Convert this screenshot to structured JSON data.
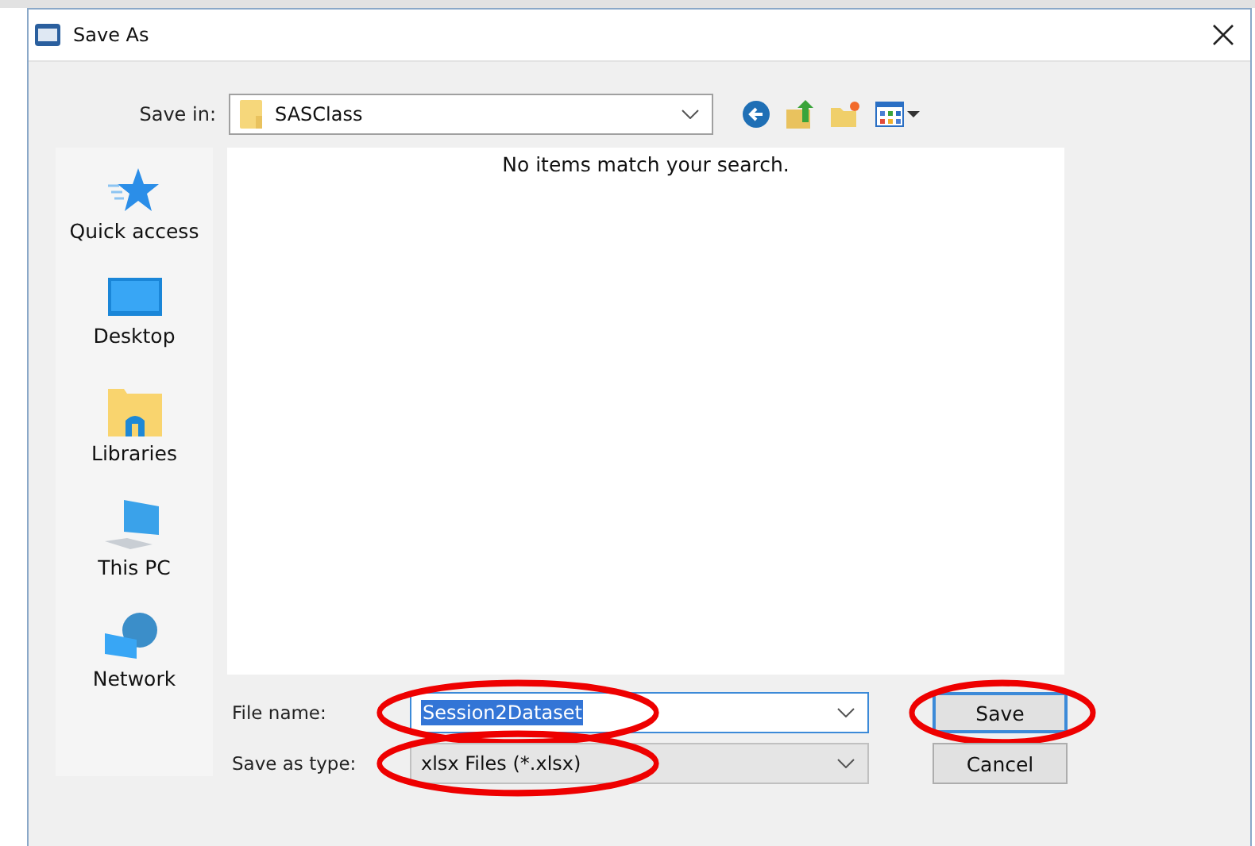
{
  "window": {
    "title": "Save As"
  },
  "save_in": {
    "label": "Save in:",
    "value": "SASClass"
  },
  "places": [
    {
      "kind": "star",
      "label": "Quick access"
    },
    {
      "kind": "desktop",
      "label": "Desktop"
    },
    {
      "kind": "libraries",
      "label": "Libraries"
    },
    {
      "kind": "pc",
      "label": "This PC"
    },
    {
      "kind": "network",
      "label": "Network"
    }
  ],
  "file_list": {
    "empty_message": "No items match your search."
  },
  "file_name": {
    "label": "File name:",
    "value": "Session2Dataset",
    "circled": true
  },
  "file_type": {
    "label": "Save as type:",
    "value": "xlsx Files (*.xlsx)",
    "circled": true
  },
  "buttons": [
    {
      "label": "Save",
      "default": true,
      "circled": true
    },
    {
      "label": "Cancel",
      "default": false,
      "circled": false
    }
  ]
}
